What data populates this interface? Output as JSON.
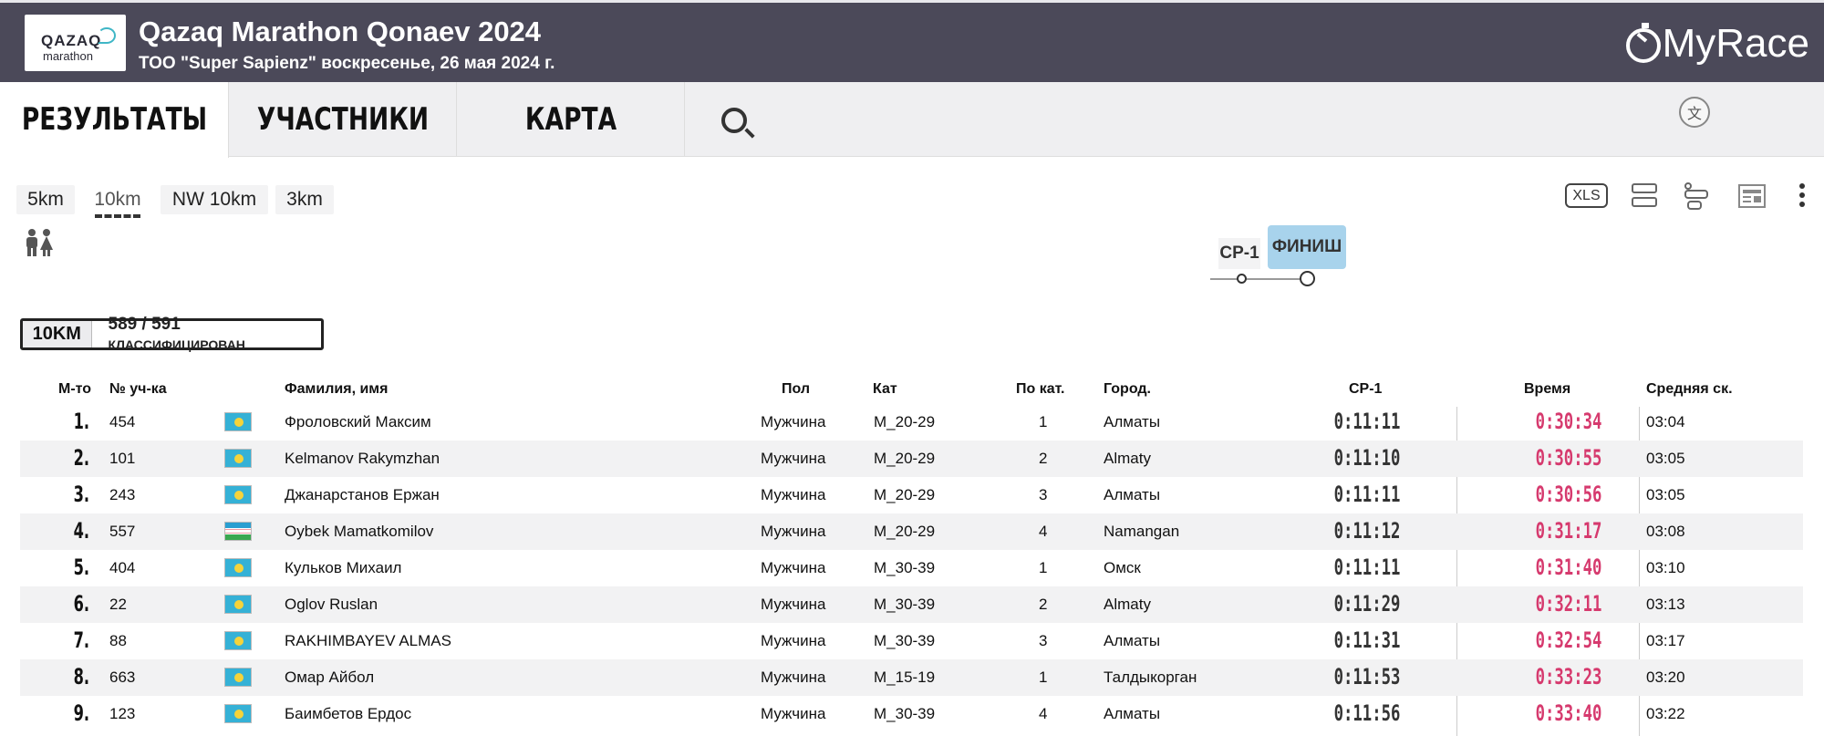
{
  "header": {
    "logo_line1": "QAZAQ",
    "logo_line2": "marathon",
    "title": "Qazaq Marathon Qonaev 2024",
    "subtitle": "ТОО \"Super Sapienz\" воскресенье, 26 мая 2024 г.",
    "brand": "MyRace"
  },
  "nav": {
    "tabs": [
      "РЕЗУЛЬТАТЫ",
      "УЧАСТНИКИ",
      "КАРТА"
    ],
    "active_tab": 0,
    "lang_icon": "文"
  },
  "distances": {
    "items": [
      "5km",
      "10km",
      "NW 10km",
      "3km"
    ],
    "active": 1
  },
  "toolbar": {
    "xls_label": "XLS"
  },
  "checkpoints": {
    "cp1": "CP-1",
    "finish": "ФИНИШ"
  },
  "classified": {
    "distance": "10KM",
    "count": "589",
    "separator": "/",
    "total": "591",
    "label": "КЛАССИФИЦИРОВАН"
  },
  "table": {
    "headers": {
      "place": "М-то",
      "bib": "№ уч-ка",
      "name": "Фамилия, имя",
      "gender": "Пол",
      "cat": "Кат",
      "cat_place": "По кат.",
      "city": "Город.",
      "cp1": "CP-1",
      "time": "Время",
      "pace": "Средняя ск."
    },
    "rows": [
      {
        "place": "1.",
        "bib": "454",
        "flag": "kz",
        "name": "Фроловский Максим",
        "gender": "Мужчина",
        "cat": "M_20-29",
        "cat_place": "1",
        "city": "Алматы",
        "cp1": "0:11:11",
        "time": "0:30:34",
        "pace": "03:04"
      },
      {
        "place": "2.",
        "bib": "101",
        "flag": "kz",
        "name": "Kelmanov Rakymzhan",
        "gender": "Мужчина",
        "cat": "M_20-29",
        "cat_place": "2",
        "city": "Almaty",
        "cp1": "0:11:10",
        "time": "0:30:55",
        "pace": "03:05"
      },
      {
        "place": "3.",
        "bib": "243",
        "flag": "kz",
        "name": "Джанарстанов Ержан",
        "gender": "Мужчина",
        "cat": "M_20-29",
        "cat_place": "3",
        "city": "Алматы",
        "cp1": "0:11:11",
        "time": "0:30:56",
        "pace": "03:05"
      },
      {
        "place": "4.",
        "bib": "557",
        "flag": "uz",
        "name": "Oybek Mamatkomilov",
        "gender": "Мужчина",
        "cat": "M_20-29",
        "cat_place": "4",
        "city": "Namangan",
        "cp1": "0:11:12",
        "time": "0:31:17",
        "pace": "03:08"
      },
      {
        "place": "5.",
        "bib": "404",
        "flag": "kz",
        "name": "Кульков Михаил",
        "gender": "Мужчина",
        "cat": "M_30-39",
        "cat_place": "1",
        "city": "Омск",
        "cp1": "0:11:11",
        "time": "0:31:40",
        "pace": "03:10"
      },
      {
        "place": "6.",
        "bib": "22",
        "flag": "kz",
        "name": "Oglov Ruslan",
        "gender": "Мужчина",
        "cat": "M_30-39",
        "cat_place": "2",
        "city": "Almaty",
        "cp1": "0:11:29",
        "time": "0:32:11",
        "pace": "03:13"
      },
      {
        "place": "7.",
        "bib": "88",
        "flag": "kz",
        "name": "RAKHIMBAYEV ALMAS",
        "gender": "Мужчина",
        "cat": "M_30-39",
        "cat_place": "3",
        "city": "Алматы",
        "cp1": "0:11:31",
        "time": "0:32:54",
        "pace": "03:17"
      },
      {
        "place": "8.",
        "bib": "663",
        "flag": "kz",
        "name": "Омар Айбол",
        "gender": "Мужчина",
        "cat": "M_15-19",
        "cat_place": "1",
        "city": "Талдыкорган",
        "cp1": "0:11:53",
        "time": "0:33:23",
        "pace": "03:20"
      },
      {
        "place": "9.",
        "bib": "123",
        "flag": "kz",
        "name": "Баимбетов Ердос",
        "gender": "Мужчина",
        "cat": "M_30-39",
        "cat_place": "4",
        "city": "Алматы",
        "cp1": "0:11:56",
        "time": "0:33:40",
        "pace": "03:22"
      }
    ]
  },
  "colors": {
    "header_bg": "#4b4959",
    "finish_time": "#d63a6e",
    "finish_chip": "#a8d3ec"
  }
}
